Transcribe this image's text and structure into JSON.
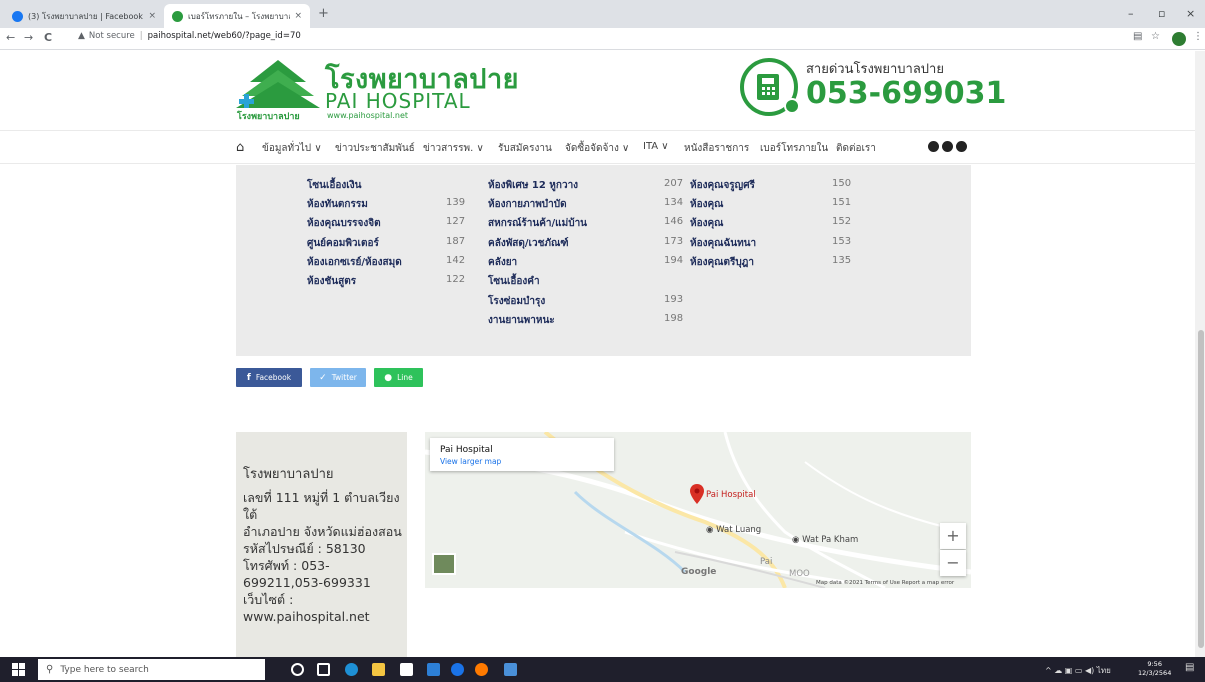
{
  "browser": {
    "tabs": [
      {
        "title": "(3) โรงพยาบาลปาย | Facebook",
        "active": false,
        "favicon_color": "#1877f2"
      },
      {
        "title": "เบอร์โทรภายใน – โรงพยาบาลปาย",
        "active": true,
        "favicon_color": "#2b9b3f"
      }
    ],
    "new_tab": "+",
    "close_glyph": "×",
    "controls": {
      "minimize": "–",
      "maximize": "▫",
      "close": "×"
    },
    "nav": {
      "back": "←",
      "forward": "→",
      "reload": "C"
    },
    "security_icon": "▲",
    "security": "Not secure",
    "separator": "|",
    "url": "paihospital.net/web60/?page_id=70",
    "tools": {
      "translate": "▤",
      "star": "☆",
      "menu": "⋮"
    }
  },
  "header": {
    "logo_th": "โรงพยาบาลปาย",
    "logo_en": "PAI HOSPITAL",
    "logo_url": "www.paihospital.net",
    "logo_small": "โรงพยาบาลปาย",
    "hotline_label": "สายด่วนโรงพยาบาลปาย",
    "hotline_number": "053-699031"
  },
  "nav": {
    "items": [
      "ข้อมูลทั่วไป ∨",
      "ข่าวประชาสัมพันธ์",
      "ข่าวสารรพ. ∨",
      "รับสมัครงาน",
      "จัดซื้อจัดจ้าง ∨",
      "ITA ∨",
      "หนังสือราชการ",
      "เบอร์โทรภายใน",
      "ติดต่อเรา"
    ]
  },
  "directory": {
    "col1": [
      {
        "name": "โซนเอื้องเงิน",
        "ext": ""
      },
      {
        "name": "ห้องทันตกรรม",
        "ext": "139"
      },
      {
        "name": "ห้องคุณบรรจงจิต",
        "ext": "127"
      },
      {
        "name": "ศูนย์คอมพิวเตอร์",
        "ext": "187"
      },
      {
        "name": "ห้องเอกซเรย์/ห้องสมุด",
        "ext": "142"
      },
      {
        "name": "ห้องชันสูตร",
        "ext": "122"
      }
    ],
    "col2": [
      {
        "name": "ห้องพิเศษ 12 หูกวาง",
        "ext": "207"
      },
      {
        "name": "ห้องกายภาพบำบัด",
        "ext": "134"
      },
      {
        "name": "สหกรณ์ร้านค้า/แม่บ้าน",
        "ext": "146"
      },
      {
        "name": "คลังพัสดุ/เวชภัณฑ์",
        "ext": "173"
      },
      {
        "name": "คลังยา",
        "ext": "194"
      },
      {
        "name": "โซนเอื้องคำ",
        "ext": ""
      },
      {
        "name": "โรงซ่อมบำรุง",
        "ext": "193"
      },
      {
        "name": "งานยานพาหนะ",
        "ext": "198"
      }
    ],
    "col3": [
      {
        "name": "ห้องคุณจรูญศรี",
        "ext": "150"
      },
      {
        "name": "ห้องคุณ",
        "ext": "151"
      },
      {
        "name": "ห้องคุณ",
        "ext": "152"
      },
      {
        "name": "ห้องคุณฉันทนา",
        "ext": "153"
      },
      {
        "name": "ห้องคุณตรีบุฎา",
        "ext": "135"
      }
    ]
  },
  "share": {
    "facebook": {
      "icon": "f",
      "label": "Facebook",
      "color": "#3b5998"
    },
    "twitter": {
      "icon": "✓",
      "label": "Twitter",
      "color": "#7db6ec"
    },
    "line": {
      "icon": "●",
      "label": "Line",
      "color": "#2ec25b"
    }
  },
  "address": {
    "title": "โรงพยาบาลปาย",
    "line1": "เลขที่ 111 หมู่ที่ 1 ตำบลเวียงใต้",
    "line2": "อำเภอปาย จังหวัดแม่ฮ่องสอน",
    "line3": "รหัสไปรษณีย์ : 58130",
    "line4": "โทรศัพท์ : 053-699211,053-699331",
    "line5": "เว็บไซต์ :",
    "line6": "www.paihospital.net"
  },
  "map": {
    "card_title": "Pai Hospital",
    "card_link": "View larger map",
    "marker_label": "Pai Hospital",
    "labels": [
      "Wat Luang",
      "Wat Pa Kham",
      "Pai",
      "MOO"
    ],
    "zoom_in": "+",
    "zoom_out": "−",
    "google": "Google",
    "footer": "Map data ©2021   Terms of Use   Report a map error"
  },
  "taskbar": {
    "search_icon": "⚲",
    "search_placeholder": "Type here to search",
    "tray": "^ ☁ ▣ ▭ ◀) ไทย",
    "time": "9:56",
    "date": "12/3/2564",
    "notification_icon": "▤"
  }
}
